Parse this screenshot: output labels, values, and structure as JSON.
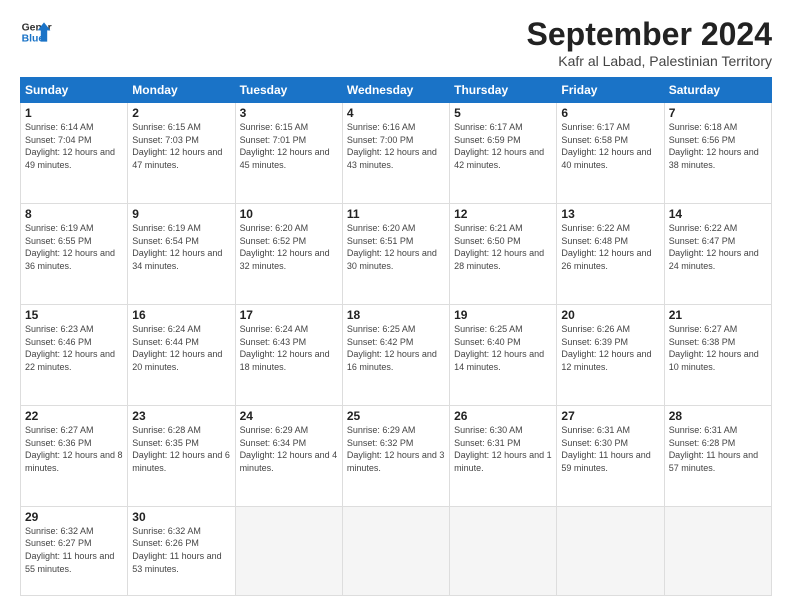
{
  "logo": {
    "line1": "General",
    "line2": "Blue"
  },
  "title": "September 2024",
  "subtitle": "Kafr al Labad, Palestinian Territory",
  "weekdays": [
    "Sunday",
    "Monday",
    "Tuesday",
    "Wednesday",
    "Thursday",
    "Friday",
    "Saturday"
  ],
  "weeks": [
    [
      {
        "day": 1,
        "rise": "6:14 AM",
        "set": "7:04 PM",
        "daylight": "12 hours and 49 minutes."
      },
      {
        "day": 2,
        "rise": "6:15 AM",
        "set": "7:03 PM",
        "daylight": "12 hours and 47 minutes."
      },
      {
        "day": 3,
        "rise": "6:15 AM",
        "set": "7:01 PM",
        "daylight": "12 hours and 45 minutes."
      },
      {
        "day": 4,
        "rise": "6:16 AM",
        "set": "7:00 PM",
        "daylight": "12 hours and 43 minutes."
      },
      {
        "day": 5,
        "rise": "6:17 AM",
        "set": "6:59 PM",
        "daylight": "12 hours and 42 minutes."
      },
      {
        "day": 6,
        "rise": "6:17 AM",
        "set": "6:58 PM",
        "daylight": "12 hours and 40 minutes."
      },
      {
        "day": 7,
        "rise": "6:18 AM",
        "set": "6:56 PM",
        "daylight": "12 hours and 38 minutes."
      }
    ],
    [
      {
        "day": 8,
        "rise": "6:19 AM",
        "set": "6:55 PM",
        "daylight": "12 hours and 36 minutes."
      },
      {
        "day": 9,
        "rise": "6:19 AM",
        "set": "6:54 PM",
        "daylight": "12 hours and 34 minutes."
      },
      {
        "day": 10,
        "rise": "6:20 AM",
        "set": "6:52 PM",
        "daylight": "12 hours and 32 minutes."
      },
      {
        "day": 11,
        "rise": "6:20 AM",
        "set": "6:51 PM",
        "daylight": "12 hours and 30 minutes."
      },
      {
        "day": 12,
        "rise": "6:21 AM",
        "set": "6:50 PM",
        "daylight": "12 hours and 28 minutes."
      },
      {
        "day": 13,
        "rise": "6:22 AM",
        "set": "6:48 PM",
        "daylight": "12 hours and 26 minutes."
      },
      {
        "day": 14,
        "rise": "6:22 AM",
        "set": "6:47 PM",
        "daylight": "12 hours and 24 minutes."
      }
    ],
    [
      {
        "day": 15,
        "rise": "6:23 AM",
        "set": "6:46 PM",
        "daylight": "12 hours and 22 minutes."
      },
      {
        "day": 16,
        "rise": "6:24 AM",
        "set": "6:44 PM",
        "daylight": "12 hours and 20 minutes."
      },
      {
        "day": 17,
        "rise": "6:24 AM",
        "set": "6:43 PM",
        "daylight": "12 hours and 18 minutes."
      },
      {
        "day": 18,
        "rise": "6:25 AM",
        "set": "6:42 PM",
        "daylight": "12 hours and 16 minutes."
      },
      {
        "day": 19,
        "rise": "6:25 AM",
        "set": "6:40 PM",
        "daylight": "12 hours and 14 minutes."
      },
      {
        "day": 20,
        "rise": "6:26 AM",
        "set": "6:39 PM",
        "daylight": "12 hours and 12 minutes."
      },
      {
        "day": 21,
        "rise": "6:27 AM",
        "set": "6:38 PM",
        "daylight": "12 hours and 10 minutes."
      }
    ],
    [
      {
        "day": 22,
        "rise": "6:27 AM",
        "set": "6:36 PM",
        "daylight": "12 hours and 8 minutes."
      },
      {
        "day": 23,
        "rise": "6:28 AM",
        "set": "6:35 PM",
        "daylight": "12 hours and 6 minutes."
      },
      {
        "day": 24,
        "rise": "6:29 AM",
        "set": "6:34 PM",
        "daylight": "12 hours and 4 minutes."
      },
      {
        "day": 25,
        "rise": "6:29 AM",
        "set": "6:32 PM",
        "daylight": "12 hours and 3 minutes."
      },
      {
        "day": 26,
        "rise": "6:30 AM",
        "set": "6:31 PM",
        "daylight": "12 hours and 1 minute."
      },
      {
        "day": 27,
        "rise": "6:31 AM",
        "set": "6:30 PM",
        "daylight": "11 hours and 59 minutes."
      },
      {
        "day": 28,
        "rise": "6:31 AM",
        "set": "6:28 PM",
        "daylight": "11 hours and 57 minutes."
      }
    ],
    [
      {
        "day": 29,
        "rise": "6:32 AM",
        "set": "6:27 PM",
        "daylight": "11 hours and 55 minutes."
      },
      {
        "day": 30,
        "rise": "6:32 AM",
        "set": "6:26 PM",
        "daylight": "11 hours and 53 minutes."
      },
      null,
      null,
      null,
      null,
      null
    ]
  ]
}
